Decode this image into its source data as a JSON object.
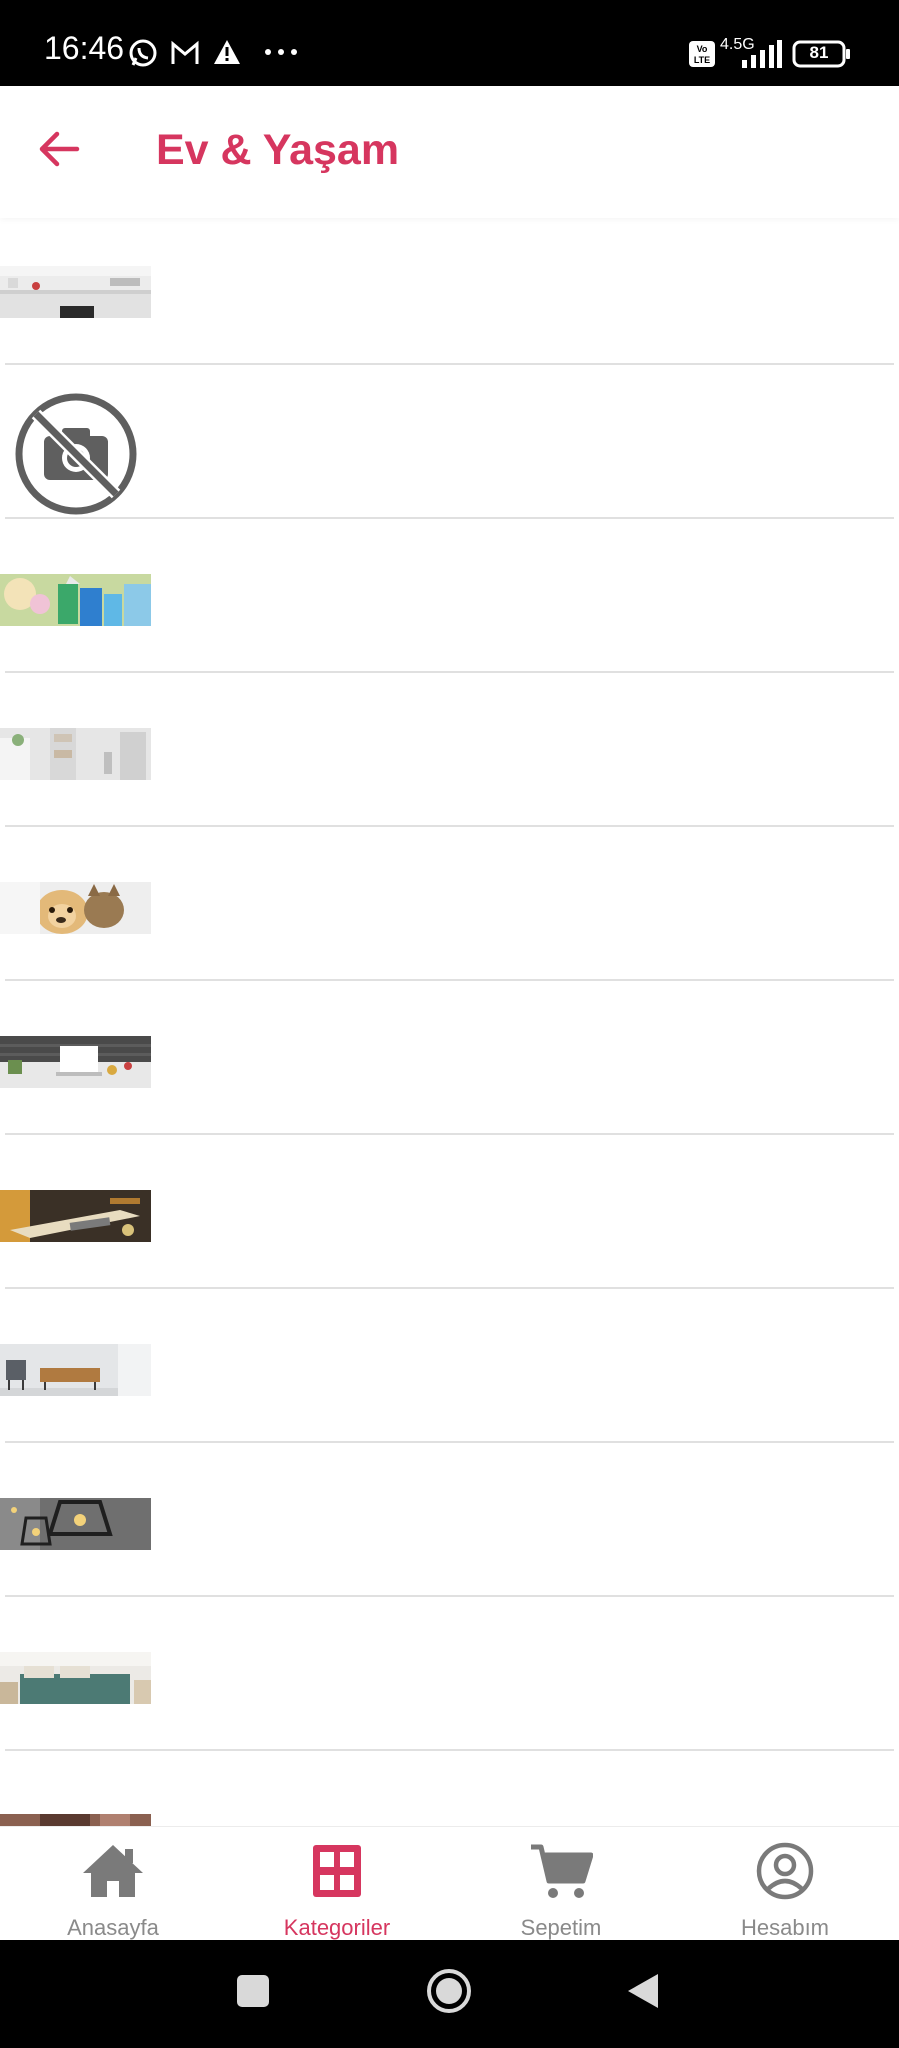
{
  "status_bar": {
    "time": "16:46",
    "network": "4.5G",
    "volte": "Vo LTE",
    "battery": "81"
  },
  "app_bar": {
    "title": "Ev & Yaşam",
    "back_icon": "arrow-left-icon"
  },
  "category_list": {
    "items": [
      {
        "name": "category-item-1",
        "thumb": "kitchen-image"
      },
      {
        "name": "category-item-2",
        "thumb": "no-image-placeholder"
      },
      {
        "name": "category-item-3",
        "thumb": "cleaning-image"
      },
      {
        "name": "category-item-4",
        "thumb": "bathroom-image"
      },
      {
        "name": "category-item-5",
        "thumb": "pet-image"
      },
      {
        "name": "category-item-6",
        "thumb": "office-image"
      },
      {
        "name": "category-item-7",
        "thumb": "diy-tools-image"
      },
      {
        "name": "category-item-8",
        "thumb": "furniture-image"
      },
      {
        "name": "category-item-9",
        "thumb": "lighting-image"
      },
      {
        "name": "category-item-10",
        "thumb": "bedroom-image"
      },
      {
        "name": "category-item-11",
        "thumb": "partial-image"
      }
    ]
  },
  "bottom_nav": {
    "items": [
      {
        "label": "Anasayfa",
        "icon": "home-icon",
        "active": false
      },
      {
        "label": "Kategoriler",
        "icon": "grid-icon",
        "active": true
      },
      {
        "label": "Sepetim",
        "icon": "cart-icon",
        "active": false
      },
      {
        "label": "Hesabım",
        "icon": "account-icon",
        "active": false
      }
    ]
  },
  "colors": {
    "accent": "#d6365f",
    "inactive": "#8a8a8a",
    "divider": "#e0e0e0"
  }
}
